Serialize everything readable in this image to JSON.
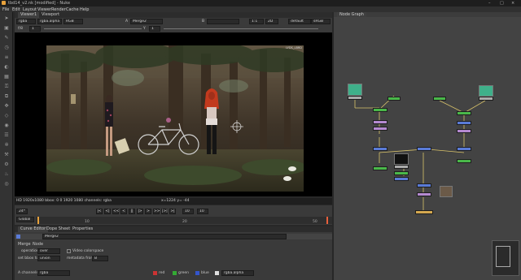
{
  "window": {
    "title": "tbd14_v2.nk [modified] - Nuke",
    "controls": [
      "–",
      "□",
      "×"
    ]
  },
  "menu": [
    "File",
    "Edit",
    "Layout",
    "Viewer",
    "Render",
    "Cache",
    "Help"
  ],
  "toolbar_icons": [
    "pointer-icon",
    "image-icon",
    "draw-icon",
    "time-icon",
    "channel-icon",
    "color-icon",
    "filter-icon",
    "keyer-icon",
    "merge-icon",
    "transform-icon",
    "3d-icon",
    "views-icon",
    "metadata-icon",
    "particles-icon",
    "toolsets-icon",
    "other-icon",
    "furnace-icon",
    "ocula-icon"
  ],
  "viewer_tabs": [
    "Viewer1",
    "Viewport"
  ],
  "viewer_controls": {
    "row1": {
      "channels": "rgba",
      "channel2": "rgba.alpha",
      "mode": "RGB",
      "input_a": "A",
      "node_a": "Merge2",
      "input_b": "B",
      "node_b": "",
      "zoom": "1:1",
      "proxy": "2D",
      "lut": "default",
      "value": "sRGB"
    },
    "row2": {
      "f_label": "f/8",
      "f_value": "1",
      "y_label": "Y",
      "y_value": "1"
    }
  },
  "viewer": {
    "corner_label": "LYDS_LBRD",
    "info": "HD 1920x1080 bbox: 0 0 1920 1080 channels: rgba",
    "coords": "x=1224 y= -44"
  },
  "timeline": {
    "fps": "24*",
    "play_buttons": [
      "|<",
      "<|",
      "<<",
      "<",
      "||",
      "|>",
      ">",
      ">>",
      "|>|",
      ">|"
    ],
    "frame": "10",
    "increment": "10",
    "mode": "Global",
    "ruler_ticks": [
      "1",
      "10",
      "20",
      "50"
    ]
  },
  "panel_tabs": [
    "Curve Editor",
    "Dope Sheet",
    "Properties"
  ],
  "properties": {
    "node_name": "Merge2",
    "node_tabs": [
      "Merge",
      "Node"
    ],
    "operation_label": "operation",
    "operation_value": "over",
    "video_colorspace": "Video colorspace",
    "set_bbox_label": "set bbox to",
    "set_bbox_value": "union",
    "metadata_label": "metadata from",
    "metadata_value": "B",
    "a_channels_label": "A channels",
    "a_channels_value": "rgba",
    "a_red": "red",
    "a_green": "green",
    "a_blue": "blue",
    "a_alpha": "rgba.alpha"
  },
  "node_graph": {
    "tab": "Node Graph"
  },
  "colors": {
    "accent_orange": "#e8a23c",
    "node_green": "#4ab84a",
    "node_purple": "#b58ad1",
    "node_blue": "#5a7bd8",
    "node_yellow": "#d4a850"
  }
}
